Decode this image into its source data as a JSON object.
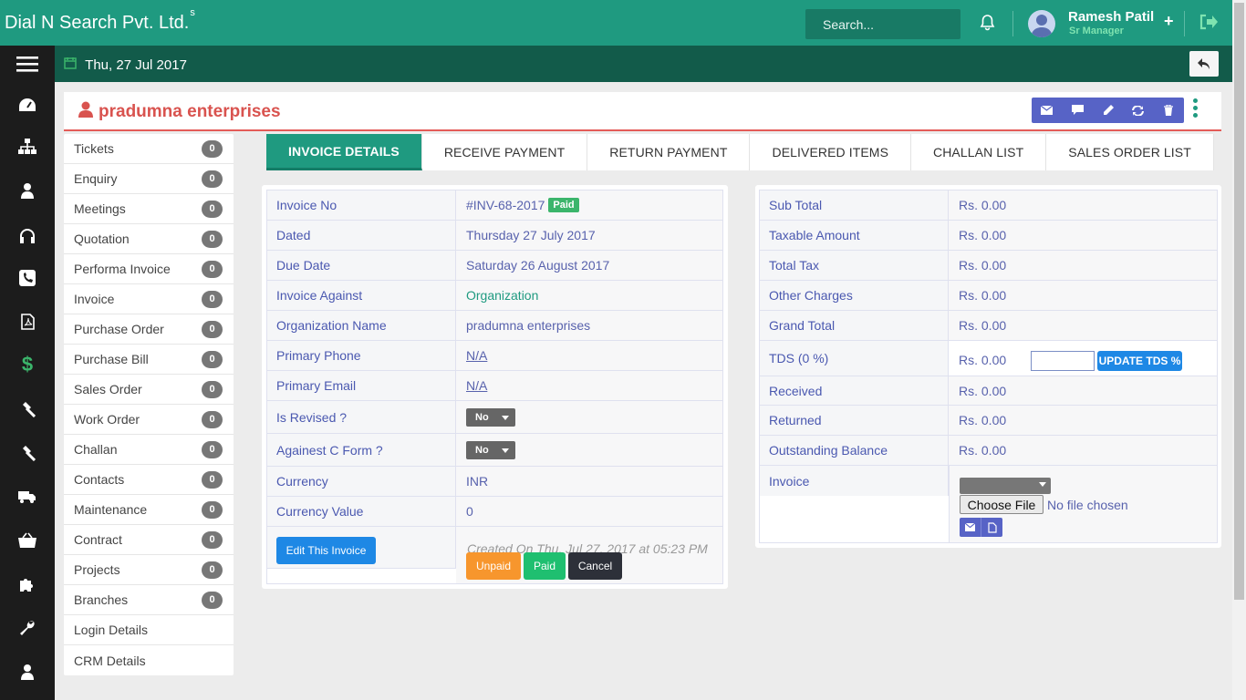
{
  "app": {
    "brand": "Dial N Search Pvt. Ltd.",
    "brand_sup": "s"
  },
  "topbar": {
    "search_placeholder": "Search...",
    "user_name": "Ramesh Patil",
    "user_role": "Sr Manager",
    "plus": "+"
  },
  "subbar": {
    "date": "Thu, 27 Jul 2017"
  },
  "customer": {
    "name": "pradumna enterprises"
  },
  "menu": [
    {
      "label": "Tickets",
      "count": "0"
    },
    {
      "label": "Enquiry",
      "count": "0"
    },
    {
      "label": "Meetings",
      "count": "0"
    },
    {
      "label": "Quotation",
      "count": "0"
    },
    {
      "label": "Performa Invoice",
      "count": "0"
    },
    {
      "label": "Invoice",
      "count": "0"
    },
    {
      "label": "Purchase Order",
      "count": "0"
    },
    {
      "label": "Purchase Bill",
      "count": "0"
    },
    {
      "label": "Sales Order",
      "count": "0"
    },
    {
      "label": "Work Order",
      "count": "0"
    },
    {
      "label": "Challan",
      "count": "0"
    },
    {
      "label": "Contacts",
      "count": "0"
    },
    {
      "label": "Maintenance",
      "count": "0"
    },
    {
      "label": "Contract",
      "count": "0"
    },
    {
      "label": "Projects",
      "count": "0"
    },
    {
      "label": "Branches",
      "count": "0"
    },
    {
      "label": "Login Details"
    },
    {
      "label": "CRM Details"
    }
  ],
  "tabs": [
    "INVOICE DETAILS",
    "RECEIVE PAYMENT",
    "RETURN PAYMENT",
    "DELIVERED ITEMS",
    "CHALLAN LIST",
    "SALES ORDER LIST"
  ],
  "invoice": {
    "invoice_no_label": "Invoice No",
    "invoice_no": "#INV-68-2017",
    "status_badge": "Paid",
    "dated_label": "Dated",
    "dated": "Thursday 27 July 2017",
    "due_label": "Due Date",
    "due": "Saturday 26 August 2017",
    "against_label": "Invoice Against",
    "against": "Organization",
    "org_label": "Organization Name",
    "org": "pradumna enterprises",
    "phone_label": "Primary Phone",
    "phone": "N/A",
    "email_label": "Primary Email",
    "email": "N/A",
    "revised_label": "Is Revised ?",
    "revised": "No",
    "cform_label": "Againest C Form ?",
    "cform": "No",
    "currency_label": "Currency",
    "currency": "INR",
    "currency_value_label": "Currency Value",
    "currency_value": "0",
    "edit_button": "Edit This Invoice",
    "created_on": "Created On Thu, Jul 27, 2017 at 05:23 PM",
    "unpaid_button": "Unpaid",
    "paid_button": "Paid",
    "cancel_button": "Cancel"
  },
  "totals": {
    "sub_total_label": "Sub Total",
    "sub_total": "Rs. 0.00",
    "taxable_label": "Taxable Amount",
    "taxable": "Rs. 0.00",
    "total_tax_label": "Total Tax",
    "total_tax": "Rs. 0.00",
    "other_label": "Other Charges",
    "other": "Rs. 0.00",
    "grand_label": "Grand Total",
    "grand": "Rs. 0.00",
    "tds_label": "TDS (0 %)",
    "tds": "Rs. 0.00",
    "tds_button": "UPDATE TDS %",
    "received_label": "Received",
    "received": "Rs. 0.00",
    "returned_label": "Returned",
    "returned": "Rs. 0.00",
    "outstanding_label": "Outstanding Balance",
    "outstanding": "Rs. 0.00",
    "invoice_label": "Invoice",
    "choose_file": "Choose File",
    "no_file": "No file chosen"
  },
  "colors": {
    "brand": "#1f9a80",
    "brand_dark": "#125b4a",
    "accent_red": "#d9534f",
    "primary_blue": "#1e88e5"
  }
}
